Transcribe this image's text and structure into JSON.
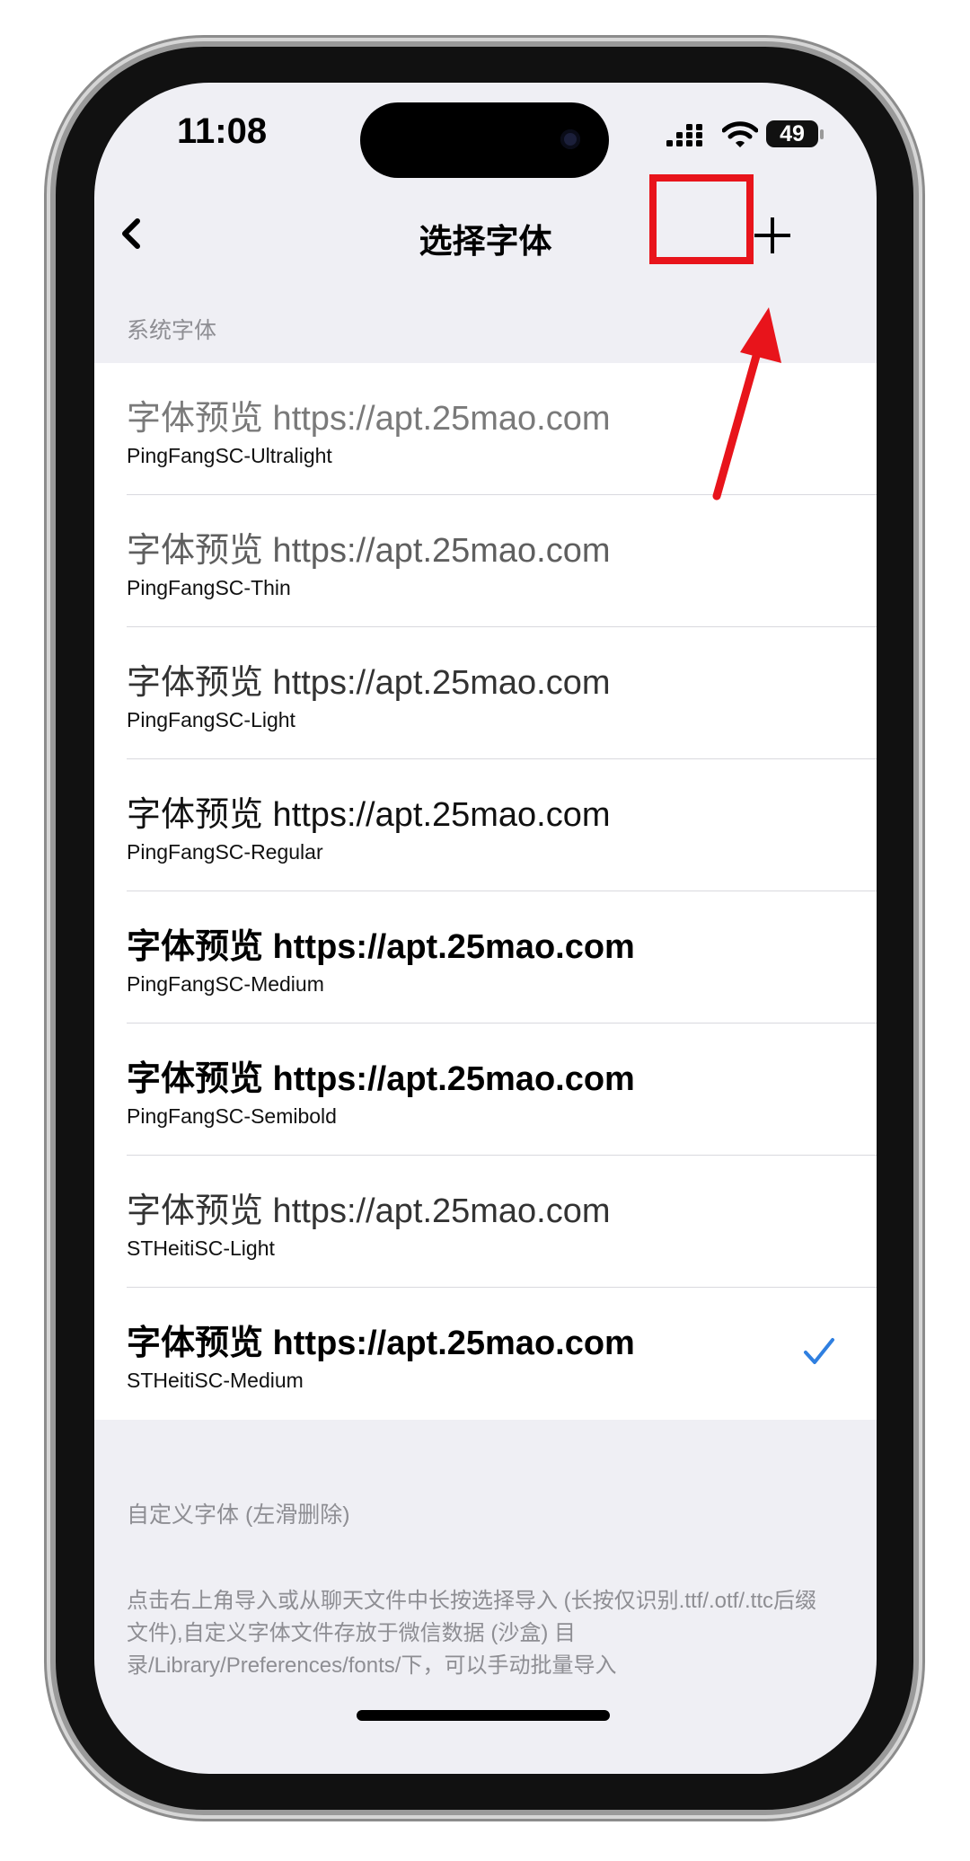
{
  "status_bar": {
    "time": "11:08",
    "battery": "49"
  },
  "nav": {
    "title": "选择字体",
    "back_icon": "chevron-left-icon",
    "add_icon": "plus-icon"
  },
  "annotation": {
    "color": "#e8141b"
  },
  "system_fonts": {
    "header": "系统字体",
    "items": [
      {
        "preview": "字体预览 https://apt.25mao.com",
        "name": "PingFangSC-Ultralight"
      },
      {
        "preview": "字体预览 https://apt.25mao.com",
        "name": "PingFangSC-Thin"
      },
      {
        "preview": "字体预览 https://apt.25mao.com",
        "name": "PingFangSC-Light"
      },
      {
        "preview": "字体预览 https://apt.25mao.com",
        "name": "PingFangSC-Regular"
      },
      {
        "preview": "字体预览 https://apt.25mao.com",
        "name": "PingFangSC-Medium"
      },
      {
        "preview": "字体预览 https://apt.25mao.com",
        "name": "PingFangSC-Semibold"
      },
      {
        "preview": "字体预览 https://apt.25mao.com",
        "name": "STHeitiSC-Light"
      },
      {
        "preview": "字体预览 https://apt.25mao.com",
        "name": "STHeitiSC-Medium",
        "selected": true
      }
    ]
  },
  "custom_fonts": {
    "header": "自定义字体 (左滑删除)",
    "description": "点击右上角导入或从聊天文件中长按选择导入 (长按仅识别.ttf/.otf/.ttc后缀文件),自定义字体文件存放于微信数据 (沙盒) 目录/Library/Preferences/fonts/下，可以手动批量导入"
  },
  "colors": {
    "accent": "#2f7fe0",
    "section_text": "#8e8e93"
  }
}
